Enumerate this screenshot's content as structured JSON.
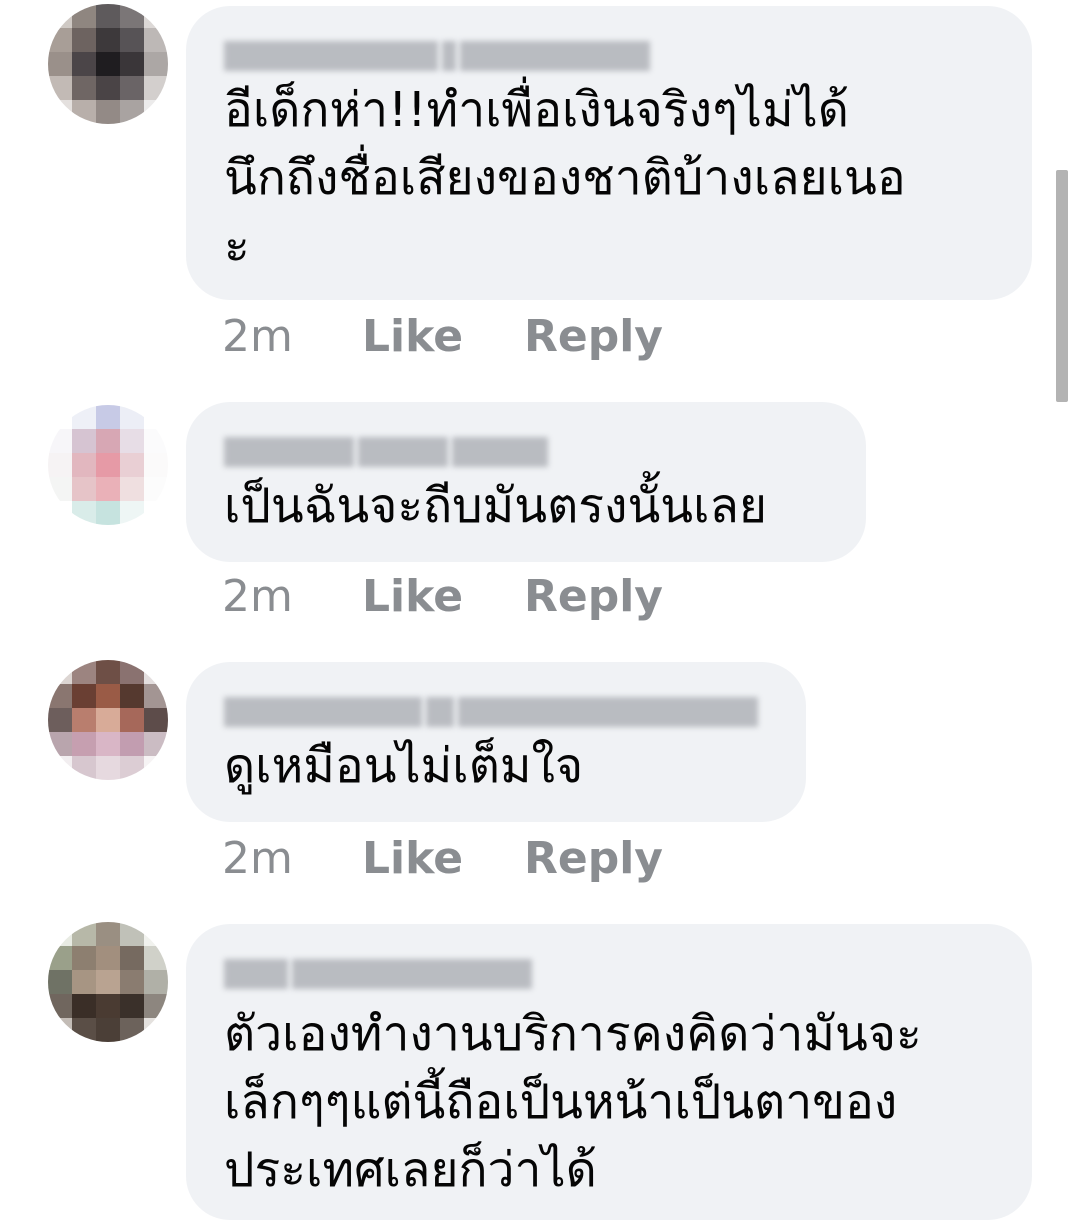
{
  "comments": [
    {
      "text": "อีเด็กห่า!!ทำเพื่อเงินจริงๆไม่ได้\nนึกถึงชื่อเสียงของชาติบ้างเลยเนอ\nะ",
      "time": "2m",
      "like": "Like",
      "reply": "Reply"
    },
    {
      "text": "เป็นฉันจะถีบมันตรงนั้นเลย",
      "time": "2m",
      "like": "Like",
      "reply": "Reply"
    },
    {
      "text": "ดูเหมือนไม่เต็มใจ",
      "time": "2m",
      "like": "Like",
      "reply": "Reply"
    },
    {
      "text": "ตัวเองทำงานบริการคงคิดว่ามันจะ\nเล็กๆๆแต่นี้ถือเป็นหน้าเป็นตาของ\nประเทศเลยก็ว่าได้"
    }
  ],
  "colors": {
    "bubble": "#f0f2f5",
    "text": "#050505",
    "meta": "#8a8d91"
  }
}
